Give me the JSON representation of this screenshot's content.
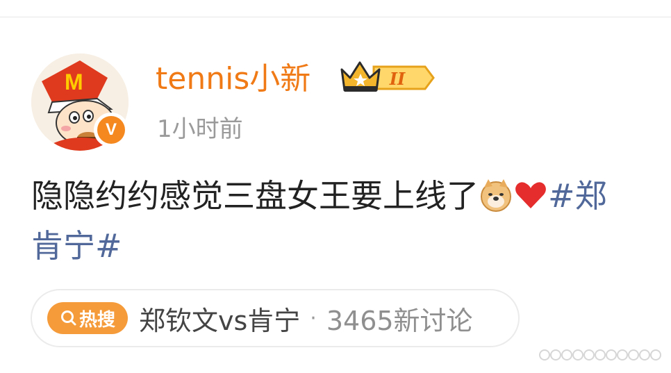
{
  "post": {
    "username": "tennis小新",
    "rank_badge_label": "II",
    "timestamp": "1小时前",
    "verified_label": "V",
    "text_main": "隐隐约约感觉三盘女王要上线了",
    "hashtag_part1": "#郑",
    "hashtag_part2": "肯宁#",
    "emojis": [
      "doge-emoji",
      "red-heart-emoji"
    ]
  },
  "hot_search": {
    "tag_label": "热搜",
    "topic": "郑钦文vs肯宁",
    "separator": "·",
    "count_text": "3465新讨论"
  },
  "colors": {
    "username": "#f07a16",
    "hashtag": "#50699a",
    "hot_tag_bg": "#f59b3a",
    "timestamp": "#9a9a9a"
  }
}
